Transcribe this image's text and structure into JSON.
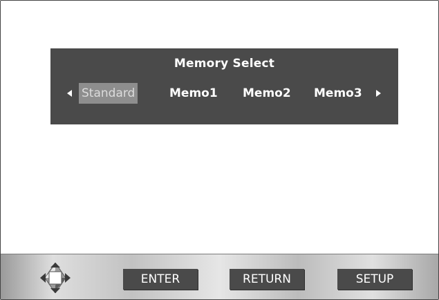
{
  "memory_select": {
    "title": "Memory Select",
    "options": [
      "Standard",
      "Memo1",
      "Memo2",
      "Memo3"
    ],
    "selected": "Standard",
    "left_arrow": "left-arrow-icon",
    "right_arrow": "right-arrow-icon"
  },
  "bottom_bar": {
    "dpad_icon": "dpad-icon",
    "enter_label": "ENTER",
    "return_label": "RETURN",
    "setup_label": "SETUP"
  },
  "colors": {
    "panel": "#4a4a4a",
    "selected_highlight": "#8e8e8e",
    "key_background": "#4a4a4a"
  }
}
